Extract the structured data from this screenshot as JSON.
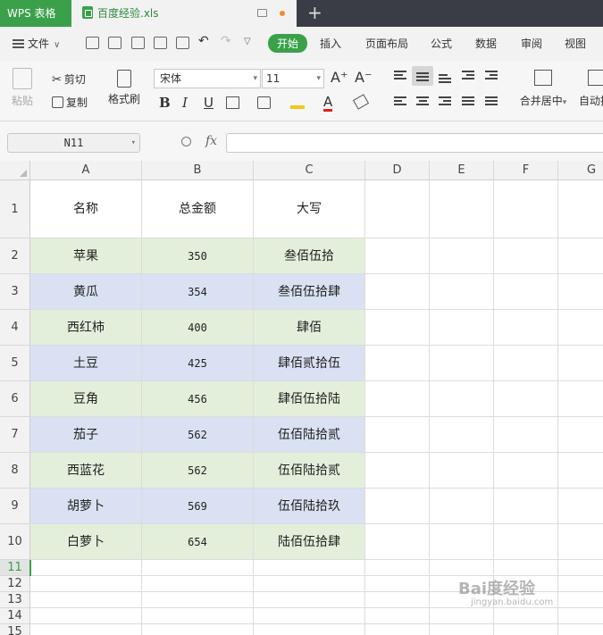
{
  "titlebar": {
    "app_name": "WPS 表格",
    "doc_tab": "百度经验.xls",
    "new_tab_symbol": "+"
  },
  "menu": {
    "file_label": "文件",
    "tabs": [
      "开始",
      "插入",
      "页面布局",
      "公式",
      "数据",
      "审阅",
      "视图"
    ],
    "active_tab": "开始"
  },
  "ribbon": {
    "paste": "粘贴",
    "cut": "剪切",
    "copy": "复制",
    "format_painter": "格式刷",
    "font_name": "宋体",
    "font_size": "11",
    "bold": "B",
    "italic": "I",
    "underline": "U",
    "font_color": "A",
    "grow_font": "A⁺",
    "shrink_font": "A⁻",
    "merge_center": "合并居中",
    "autowrap": "自动换"
  },
  "formula_bar": {
    "name_box": "N11",
    "fx": "fx",
    "value": ""
  },
  "sheet": {
    "columns": [
      "A",
      "B",
      "C",
      "D",
      "E",
      "F",
      "G"
    ],
    "header_row": [
      "名称",
      "总金额",
      "大写"
    ],
    "rows": [
      {
        "name": "苹果",
        "amount": "350",
        "upper": "叁佰伍拾"
      },
      {
        "name": "黄瓜",
        "amount": "354",
        "upper": "叁佰伍拾肆"
      },
      {
        "name": "西红柿",
        "amount": "400",
        "upper": "肆佰"
      },
      {
        "name": "土豆",
        "amount": "425",
        "upper": "肆佰贰拾伍"
      },
      {
        "name": "豆角",
        "amount": "456",
        "upper": "肆佰伍拾陆"
      },
      {
        "name": "茄子",
        "amount": "562",
        "upper": "伍佰陆拾贰"
      },
      {
        "name": "西蓝花",
        "amount": "562",
        "upper": "伍佰陆拾贰"
      },
      {
        "name": "胡萝卜",
        "amount": "569",
        "upper": "伍佰陆拾玖"
      },
      {
        "name": "白萝卜",
        "amount": "654",
        "upper": "陆佰伍拾肆"
      }
    ],
    "row_numbers": [
      "1",
      "2",
      "3",
      "4",
      "5",
      "6",
      "7",
      "8",
      "9",
      "10",
      "11",
      "12",
      "13",
      "14",
      "15"
    ],
    "active_row": "11",
    "colors": {
      "green_band": "#e3efdb",
      "blue_band": "#dae1f2",
      "accent": "#3aa14a"
    }
  },
  "watermark": {
    "main": "Bai度经验",
    "sub": "jingyan.baidu.com"
  }
}
